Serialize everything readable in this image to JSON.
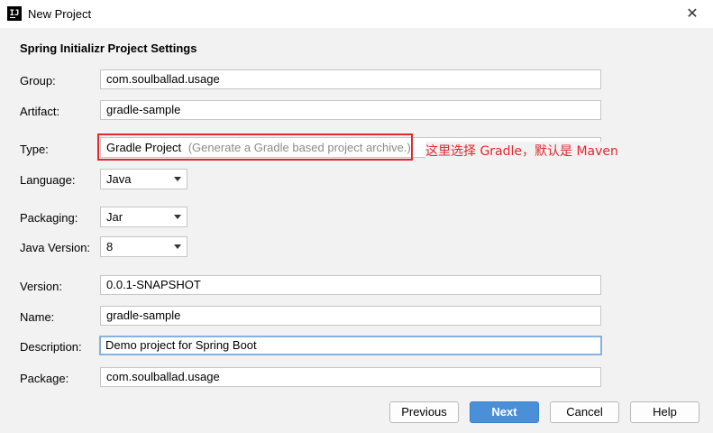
{
  "window": {
    "title": "New Project",
    "icon_text": "IJ"
  },
  "section_title": "Spring Initializr Project Settings",
  "form": {
    "group": {
      "label": "Group:",
      "value": "com.soulballad.usage"
    },
    "artifact": {
      "label": "Artifact:",
      "value": "gradle-sample"
    },
    "type": {
      "label": "Type:",
      "value": "Gradle Project",
      "hint": "(Generate a Gradle based project archive.)"
    },
    "language": {
      "label": "Language:",
      "value": "Java"
    },
    "packaging": {
      "label": "Packaging:",
      "value": "Jar"
    },
    "java_version": {
      "label": "Java Version:",
      "value": "8"
    },
    "version": {
      "label": "Version:",
      "value": "0.0.1-SNAPSHOT"
    },
    "name": {
      "label": "Name:",
      "value": "gradle-sample"
    },
    "description": {
      "label": "Description:",
      "value": "Demo project for Spring Boot"
    },
    "package": {
      "label": "Package:",
      "value": "com.soulballad.usage"
    }
  },
  "annotation": {
    "text": "这里选择 Gradle，默认是 Maven",
    "color": "#e0282e"
  },
  "buttons": {
    "previous": "Previous",
    "next": "Next",
    "cancel": "Cancel",
    "help": "Help"
  },
  "colors": {
    "primary_button": "#4a90d9",
    "focus_border": "#87b2e0",
    "background": "#f2f2f2"
  }
}
